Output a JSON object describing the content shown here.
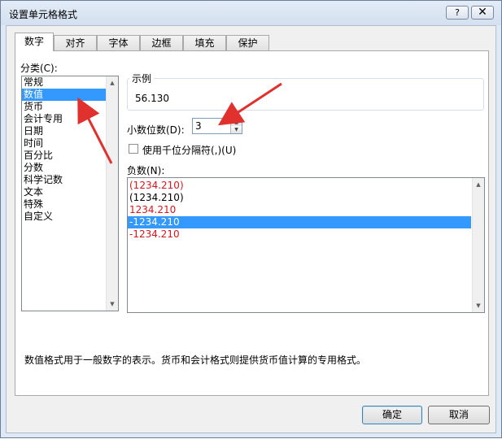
{
  "window": {
    "title": "设置单元格格式",
    "help_label": "?",
    "close_label": "✕"
  },
  "tabs": [
    "数字",
    "对齐",
    "字体",
    "边框",
    "填充",
    "保护"
  ],
  "category": {
    "label": "分类(C):",
    "items": [
      "常规",
      "数值",
      "货币",
      "会计专用",
      "日期",
      "时间",
      "百分比",
      "分数",
      "科学记数",
      "文本",
      "特殊",
      "自定义"
    ],
    "selected": "数值"
  },
  "sample": {
    "label": "示例",
    "value": "56.130"
  },
  "decimal_places": {
    "label": "小数位数(D):",
    "value": "3"
  },
  "thousands_separator": {
    "label": "使用千位分隔符(,)(U)",
    "checked": false
  },
  "negative_numbers": {
    "label": "负数(N):",
    "items": [
      {
        "text": "(1234.210)",
        "color": "#d9161c"
      },
      {
        "text": "(1234.210)",
        "color": "#000000"
      },
      {
        "text": "1234.210",
        "color": "#d9161c"
      },
      {
        "text": "-1234.210",
        "color": "#000000"
      },
      {
        "text": "-1234.210",
        "color": "#d9161c"
      }
    ],
    "selected_index": 3
  },
  "description": "数值格式用于一般数字的表示。货币和会计格式则提供货币值计算的专用格式。",
  "buttons": {
    "ok": "确定",
    "cancel": "取消"
  },
  "colors": {
    "selection": "#3399ff",
    "negative_red": "#d9161c",
    "annotation_arrow": "#e0312f"
  }
}
